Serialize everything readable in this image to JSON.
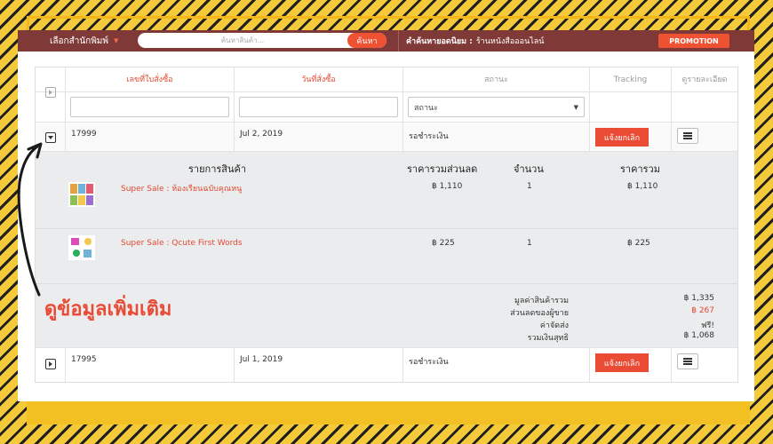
{
  "topbar": {
    "publisher_label": "เลือกสำนักพิมพ์",
    "search_placeholder": "ค้นหาสินค้า...",
    "search_button": "ค้นหา",
    "popular_label": "คำค้นหายอดนิยม :",
    "popular_value": "ร้านหนังสือออนไลน์",
    "promotion_button": "PROMOTION"
  },
  "table": {
    "headers": {
      "order_no": "เลขที่ใบสั่งซื้อ",
      "order_date": "วันที่สั่งซื้อ",
      "status": "สถานะ",
      "tracking": "Tracking",
      "details": "ดูรายละเอียด"
    },
    "status_filter_selected": "สถานะ",
    "orders": [
      {
        "order_no": "17999",
        "date": "Jul 2, 2019",
        "status": "รอชำระเงิน",
        "action_label": "แจ้งยกเลิก"
      },
      {
        "order_no": "17995",
        "date": "Jul 1, 2019",
        "status": "รอชำระเงิน",
        "action_label": "แจ้งยกเลิก"
      }
    ]
  },
  "detail": {
    "headers": {
      "product": "รายการสินค้า",
      "discounted_price": "ราคารวมส่วนลด",
      "quantity": "จำนวน",
      "total": "ราคารวม"
    },
    "items": [
      {
        "name": "Super Sale : ห้องเรียนฉบับคุณหนู",
        "price": "฿ 1,110",
        "qty": "1",
        "total": "฿ 1,110"
      },
      {
        "name": "Super Sale : Qcute First Words",
        "price": "฿ 225",
        "qty": "1",
        "total": "฿ 225"
      }
    ],
    "summary": {
      "subtotal_label": "มูลค่าสินค้ารวม",
      "subtotal_value": "฿ 1,335",
      "discount_label": "ส่วนลดของผู้ขาย",
      "discount_value": "฿ 267",
      "shipping_label": "ค่าจัดส่ง",
      "shipping_value": "ฟรี!",
      "net_label": "รวมเงินสุทธิ",
      "net_value": "฿ 1,068"
    }
  },
  "annotation": {
    "text": "ดูข้อมูลเพิ่มเติม"
  },
  "colors": {
    "accent": "#e94b35",
    "topbar": "#7f3a37",
    "frame_yellow": "#f4c93a"
  }
}
